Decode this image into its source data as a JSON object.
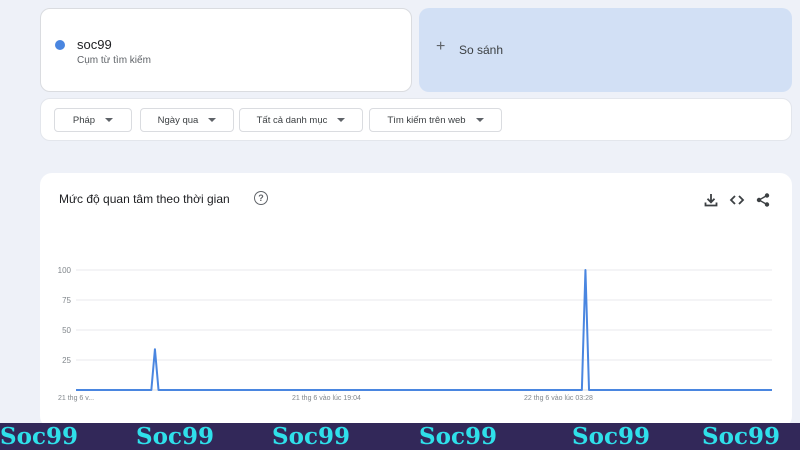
{
  "search_term": {
    "name": "soc99",
    "subtitle": "Cụm từ tìm kiếm",
    "color": "#4a86e0"
  },
  "compare": {
    "icon": "plus-icon",
    "label": "So sánh"
  },
  "filters": [
    {
      "label": "Pháp"
    },
    {
      "label": "Ngày qua"
    },
    {
      "label": "Tất cả danh mục"
    },
    {
      "label": "Tìm kiếm trên web"
    }
  ],
  "chart_section": {
    "title": "Mức độ quan tâm theo thời gian",
    "help_icon": "help-icon",
    "actions": [
      "download-icon",
      "embed-code-icon",
      "share-icon"
    ]
  },
  "chart_data": {
    "type": "line",
    "title": "Mức độ quan tâm theo thời gian",
    "ylim": [
      0,
      100
    ],
    "y_ticks": [
      "100",
      "75",
      "50",
      "25"
    ],
    "x_tick_labels": [
      "21 thg 6 v...",
      "21 thg 6 vào lúc 19:04",
      "22 thg 6 vào lúc 03:28"
    ],
    "grid": true,
    "series": [
      {
        "color": "#4a86e0",
        "values": [
          0,
          0,
          0,
          0,
          0,
          0,
          0,
          0,
          0,
          0,
          0,
          0,
          0,
          0,
          0,
          0,
          0,
          0,
          0,
          0,
          0,
          0,
          34,
          0,
          0,
          0,
          0,
          0,
          0,
          0,
          0,
          0,
          0,
          0,
          0,
          0,
          0,
          0,
          0,
          0,
          0,
          0,
          0,
          0,
          0,
          0,
          0,
          0,
          0,
          0,
          0,
          0,
          0,
          0,
          0,
          0,
          0,
          0,
          0,
          0,
          0,
          0,
          0,
          0,
          0,
          0,
          0,
          0,
          0,
          0,
          0,
          0,
          0,
          0,
          0,
          0,
          0,
          0,
          0,
          0,
          0,
          0,
          0,
          0,
          0,
          0,
          0,
          0,
          0,
          0,
          0,
          0,
          0,
          0,
          0,
          0,
          0,
          0,
          0,
          0,
          0,
          0,
          0,
          0,
          0,
          0,
          0,
          0,
          0,
          0,
          0,
          0,
          0,
          0,
          0,
          0,
          0,
          0,
          0,
          0,
          0,
          0,
          0,
          0,
          0,
          0,
          0,
          0,
          0,
          0,
          0,
          0,
          0,
          0,
          0,
          0,
          0,
          0,
          0,
          0,
          0,
          0,
          100,
          0,
          0,
          0,
          0,
          0,
          0,
          0,
          0,
          0,
          0,
          0,
          0,
          0,
          0,
          0,
          0,
          0,
          0,
          0,
          0,
          0,
          0,
          0,
          0,
          0,
          0,
          0,
          0,
          0,
          0,
          0,
          0,
          0,
          0,
          0,
          0,
          0,
          0,
          0,
          0,
          0,
          0,
          0,
          0,
          0,
          0,
          0,
          0,
          0,
          0,
          0,
          0
        ]
      }
    ]
  },
  "watermark": {
    "text": "Soc99",
    "count": 6
  }
}
